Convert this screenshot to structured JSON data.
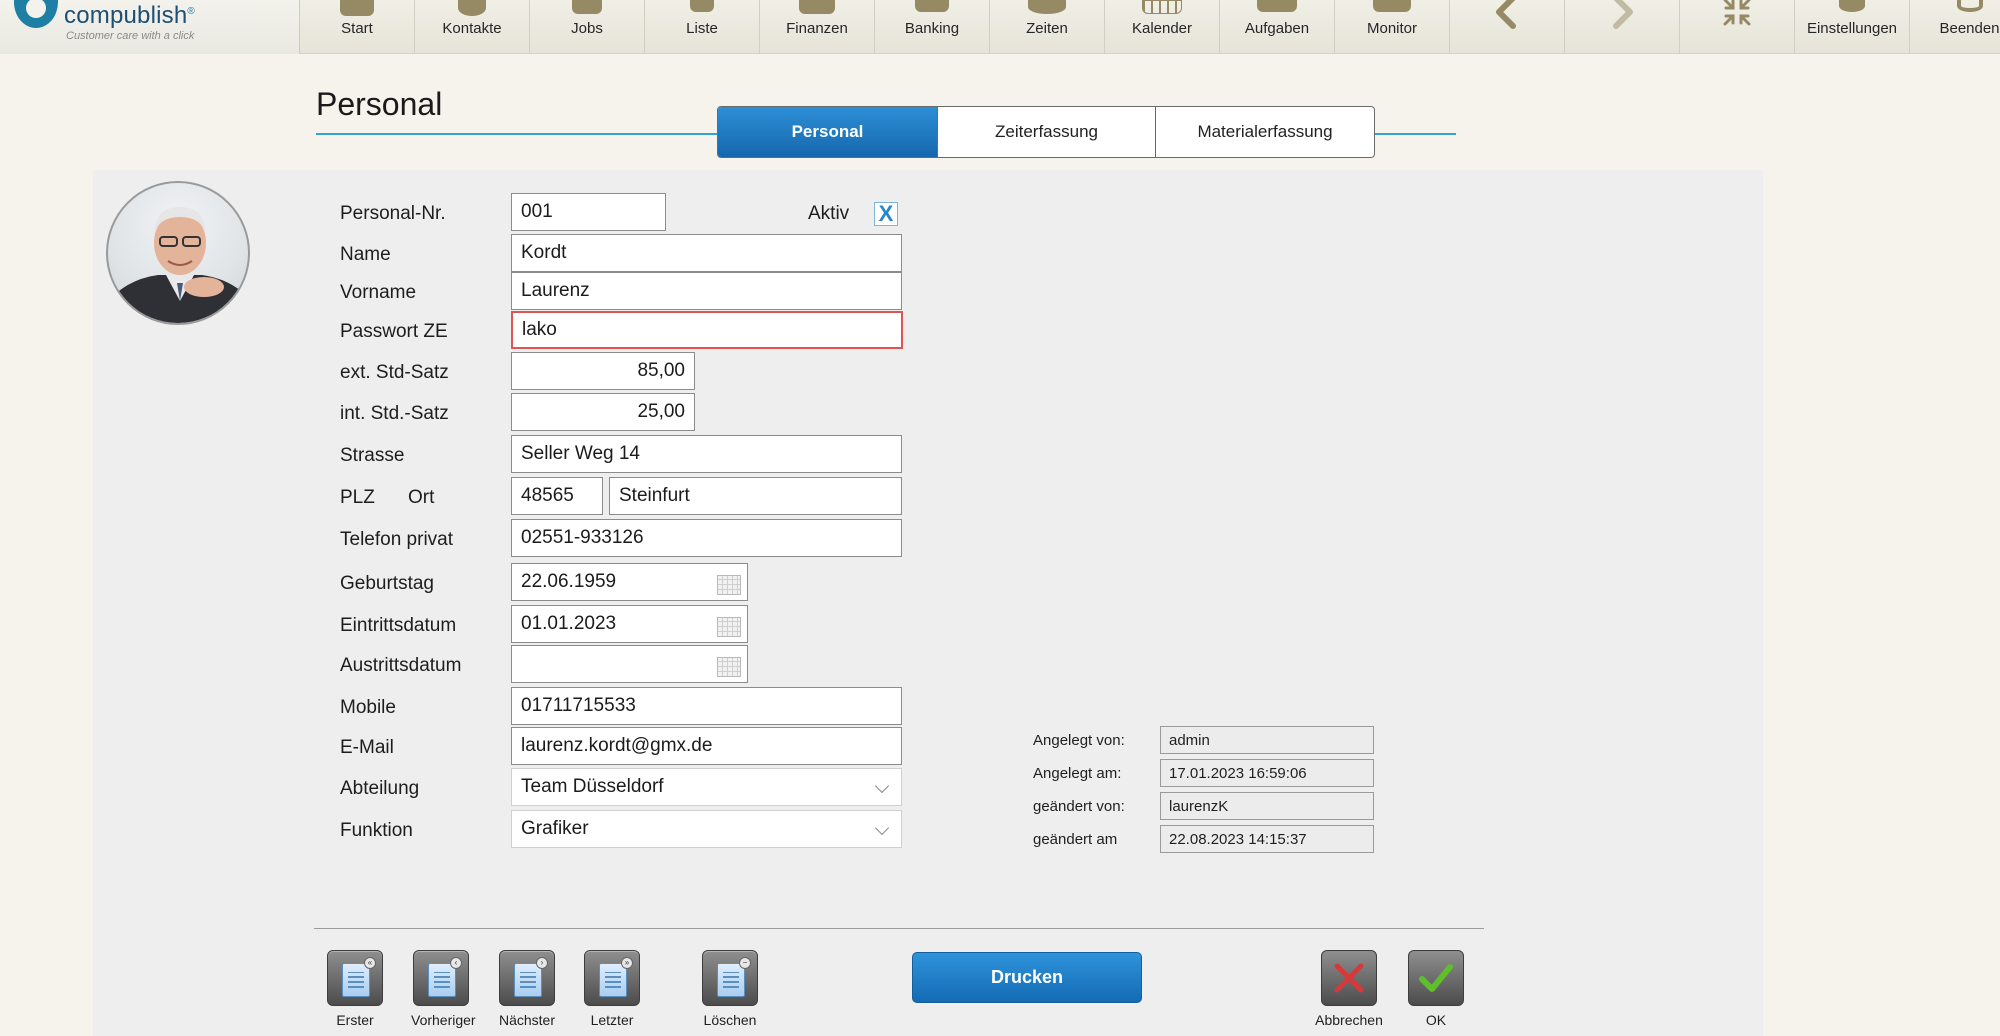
{
  "app": {
    "logo_name": "compublish",
    "logo_mark": "®",
    "logo_tagline": "Customer care with a click"
  },
  "nav": [
    {
      "label": "Start",
      "icon": "home-icon"
    },
    {
      "label": "Kontakte",
      "icon": "contacts-icon"
    },
    {
      "label": "Jobs",
      "icon": "jobs-icon"
    },
    {
      "label": "Liste",
      "icon": "list-icon"
    },
    {
      "label": "Finanzen",
      "icon": "finance-icon"
    },
    {
      "label": "Banking",
      "icon": "banking-icon"
    },
    {
      "label": "Zeiten",
      "icon": "clock-icon"
    },
    {
      "label": "Kalender",
      "icon": "calendar-icon"
    },
    {
      "label": "Aufgaben",
      "icon": "tasks-icon"
    },
    {
      "label": "Monitor",
      "icon": "monitor-icon"
    },
    {
      "label": "",
      "icon": "arrow-left-icon"
    },
    {
      "label": "",
      "icon": "arrow-right-icon"
    },
    {
      "label": "",
      "icon": "collapse-icon"
    },
    {
      "label": "Einstellungen",
      "icon": "gear-icon"
    },
    {
      "label": "Beenden",
      "icon": "power-icon"
    }
  ],
  "page": {
    "title": "Personal",
    "tabs": [
      {
        "label": "Personal",
        "active": true
      },
      {
        "label": "Zeiterfassung",
        "active": false
      },
      {
        "label": "Materialerfassung",
        "active": false
      }
    ]
  },
  "form": {
    "personal_nr": {
      "label": "Personal-Nr.",
      "value": "001"
    },
    "aktiv": {
      "label": "Aktiv",
      "checked": true,
      "mark": "X"
    },
    "name": {
      "label": "Name",
      "value": "Kordt"
    },
    "vorname": {
      "label": "Vorname",
      "value": "Laurenz"
    },
    "passwort": {
      "label": "Passwort ZE",
      "value": "lako"
    },
    "ext_satz": {
      "label": "ext. Std-Satz",
      "value": "85,00"
    },
    "int_satz": {
      "label": "int. Std.-Satz",
      "value": "25,00"
    },
    "strasse": {
      "label": "Strasse",
      "value": "Seller Weg 14"
    },
    "plz": {
      "label": "PLZ",
      "value": "48565"
    },
    "ort": {
      "label": "Ort",
      "value": "Steinfurt"
    },
    "telefon": {
      "label": "Telefon privat",
      "value": "02551-933126"
    },
    "geburtstag": {
      "label": "Geburtstag",
      "value": "22.06.1959"
    },
    "eintritt": {
      "label": "Eintrittsdatum",
      "value": "01.01.2023"
    },
    "austritt": {
      "label": "Austrittsdatum",
      "value": ""
    },
    "mobile": {
      "label": "Mobile",
      "value": "01711715533"
    },
    "email": {
      "label": "E-Mail",
      "value": "laurenz.kordt@gmx.de"
    },
    "abteilung": {
      "label": "Abteilung",
      "value": "Team Düsseldorf"
    },
    "funktion": {
      "label": "Funktion",
      "value": "Grafiker"
    }
  },
  "meta": {
    "angelegt_von": {
      "label": "Angelegt von:",
      "value": "admin"
    },
    "angelegt_am": {
      "label": "Angelegt am:",
      "value": "17.01.2023 16:59:06"
    },
    "geaendert_von": {
      "label": "geändert von:",
      "value": "laurenzK"
    },
    "geaendert_am": {
      "label": "geändert am",
      "value": "22.08.2023 14:15:37"
    }
  },
  "buttons": {
    "erster": "Erster",
    "vorheriger": "Vorheriger",
    "naechster": "Nächster",
    "letzter": "Letzter",
    "loeschen": "Löschen",
    "drucken": "Drucken",
    "abbrechen": "Abbrechen",
    "ok": "OK"
  },
  "colors": {
    "accent": "#1f7fc8",
    "title_line": "#34a3d0",
    "error_border": "#e05454",
    "cancel_red": "#d43a3a",
    "ok_green": "#5fbf2a"
  }
}
